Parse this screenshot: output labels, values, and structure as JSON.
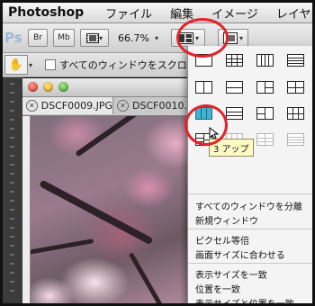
{
  "menubar": {
    "app_name": "Photoshop",
    "items": [
      "ファイル",
      "編集",
      "イメージ",
      "レイヤー"
    ]
  },
  "options_bar": {
    "ps_logo": "Ps",
    "bridge_label": "Br",
    "minibridge_label": "Mb",
    "zoom_value": "66.7%",
    "arrange_icon": "arrange-documents-icon",
    "screen_mode_icon": "screen-mode-icon"
  },
  "tool_options": {
    "tool_icon": "hand-tool-icon",
    "scroll_all_label": "すべてのウィンドウをスクロール"
  },
  "document": {
    "tabs": [
      {
        "label": "DSCF0009.JPG"
      },
      {
        "label": "DSCF0010."
      }
    ]
  },
  "arrange_menu": {
    "tooltip": "3 アップ",
    "grid_icons": [
      "consolidate-all-icon",
      "grid-4up-icon",
      "columns-4up-icon",
      "rows-4up-icon",
      "two-up-vertical-icon",
      "two-up-horizontal-icon",
      "three-up-grid-icon",
      "four-up-grid-icon",
      "three-up-vertical-icon",
      "three-up-horizontal-icon",
      "three-up-stacked-icon",
      "four-up-alt-icon",
      "five-up-icon",
      "six-up-icon",
      "six-up-alt-icon",
      "rows-3-icon"
    ],
    "items_group1": [
      "すべてのウィンドウを分離",
      "新規ウィンドウ"
    ],
    "items_group2": [
      "ピクセル等倍",
      "画面サイズに合わせる"
    ],
    "items_group3": [
      "表示サイズを一致",
      "位置を一致",
      "表示サイズと位置を一致"
    ]
  },
  "colors": {
    "highlight_ring": "#e3232a",
    "selected_icon": "#3fb3cf"
  }
}
